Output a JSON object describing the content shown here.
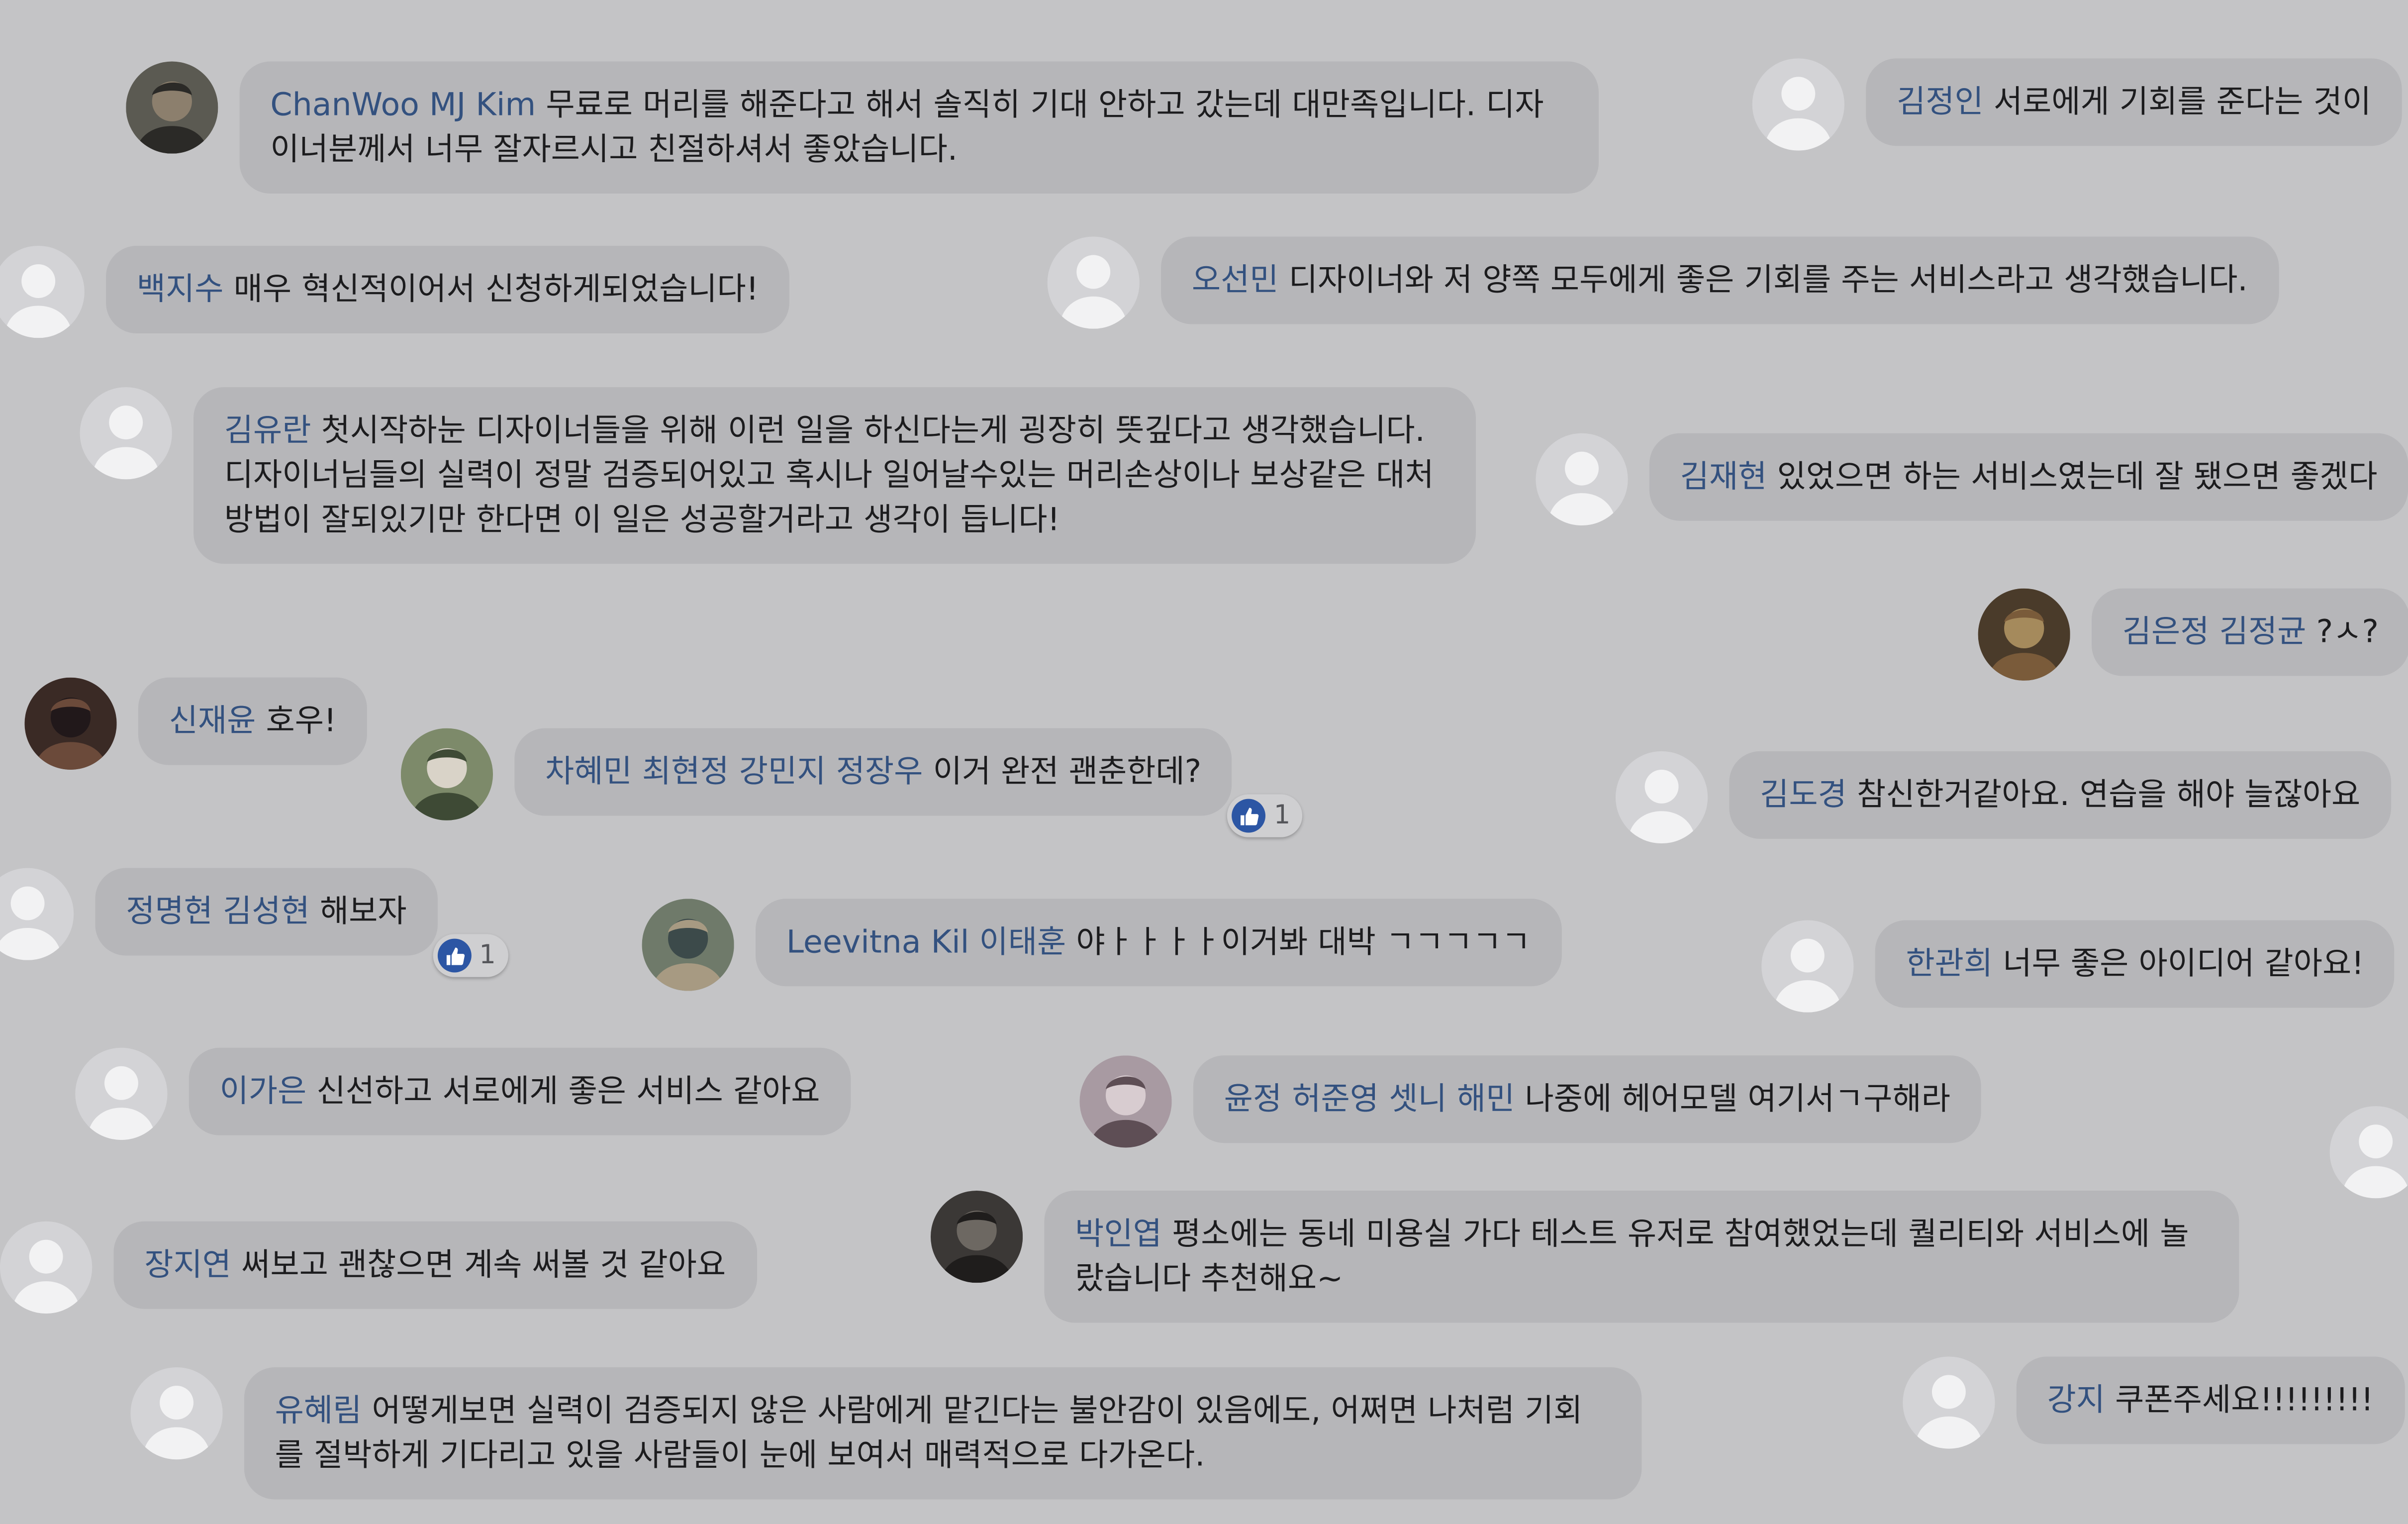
{
  "colors": {
    "background": "#c4c4c6",
    "bubble": "#b6b6b9",
    "name": "#33517f",
    "text": "#1c1c1e",
    "like_badge": "#2c56a4"
  },
  "comments": [
    {
      "names": [
        "ChanWoo MJ Kim"
      ],
      "text": "무료로 머리를 해준다고 해서 솔직히 기대 안하고 갔는데 대만족입니다. 디자이너분께서 너무 잘자르시고 친절하셔서 좋았습니다.",
      "avatar": "photo"
    },
    {
      "names": [
        "김정인"
      ],
      "text": "서로에게 기회를 준다는 것이",
      "avatar": "default"
    },
    {
      "names": [
        "백지수"
      ],
      "text": "매우 혁신적이어서 신청하게되었습니다!",
      "avatar": "default"
    },
    {
      "names": [
        "오선민"
      ],
      "text": "디자이너와 저 양쪽 모두에게 좋은 기회를 주는 서비스라고 생각했습니다.",
      "avatar": "default"
    },
    {
      "names": [
        "김유란"
      ],
      "text": "첫시작하눈 디자이너들을 위해 이런 일을 하신다는게 굉장히 뜻깊다고 생각했습니다. 디자이너님들의 실력이 정말 검증되어있고 혹시나 일어날수있는 머리손상이나 보상같은 대처방법이 잘되있기만 한다면 이 일은 성공할거라고 생각이 듭니다!",
      "avatar": "default"
    },
    {
      "names": [
        "김재현"
      ],
      "text": "있었으면 하는 서비스였는데 잘 됐으면 좋겠다",
      "avatar": "default"
    },
    {
      "names": [
        "김은정",
        "김정균"
      ],
      "text": "?ㅅ?",
      "avatar": "photo"
    },
    {
      "names": [
        "신재윤"
      ],
      "text": "호우!",
      "avatar": "photo"
    },
    {
      "names": [
        "차혜민",
        "최현정",
        "강민지",
        "정장우"
      ],
      "text": "이거 완전 괜춘한데?",
      "avatar": "photo",
      "likes": "1"
    },
    {
      "names": [
        "김도경"
      ],
      "text": "참신한거같아요. 연습을 해야 늘잖아요",
      "avatar": "default"
    },
    {
      "names": [
        "정명현",
        "김성현"
      ],
      "text": "해보자",
      "avatar": "default",
      "likes": "1"
    },
    {
      "names": [
        "Leevitna Kil",
        "이태훈"
      ],
      "text": "야ㅏㅏㅏㅏ이거봐 대박 ㄱㄱㄱㄱㄱ",
      "avatar": "photo"
    },
    {
      "names": [
        "한관희"
      ],
      "text": "너무 좋은 아이디어 같아요!",
      "avatar": "default"
    },
    {
      "names": [
        "이가은"
      ],
      "text": "신선하고 서로에게 좋은 서비스 같아요",
      "avatar": "default"
    },
    {
      "names": [
        "윤정",
        "허준영",
        "셋니",
        "해민"
      ],
      "text": "나중에 헤어모델 여기서ㄱ구해라",
      "avatar": "photo"
    },
    {
      "names": [
        "장지연"
      ],
      "text": "써보고 괜찮으면 계속 써볼 것 같아요",
      "avatar": "default"
    },
    {
      "names": [
        "박인엽"
      ],
      "text": "평소에는 동네 미용실 가다 테스트 유저로 참여했었는데 퀄리티와 서비스에 놀랐습니다 추천해요~",
      "avatar": "photo"
    },
    {
      "names": [
        "유혜림"
      ],
      "text": "어떻게보면 실력이 검증되지 않은 사람에게 맡긴다는 불안감이 있음에도, 어쩌면 나처럼 기회를 절박하게 기다리고 있을 사람들이 눈에 보여서 매력적으로 다가온다.",
      "avatar": "default"
    },
    {
      "names": [
        "강지"
      ],
      "text": "쿠폰주세요!!!!!!!!!",
      "avatar": "default"
    }
  ]
}
